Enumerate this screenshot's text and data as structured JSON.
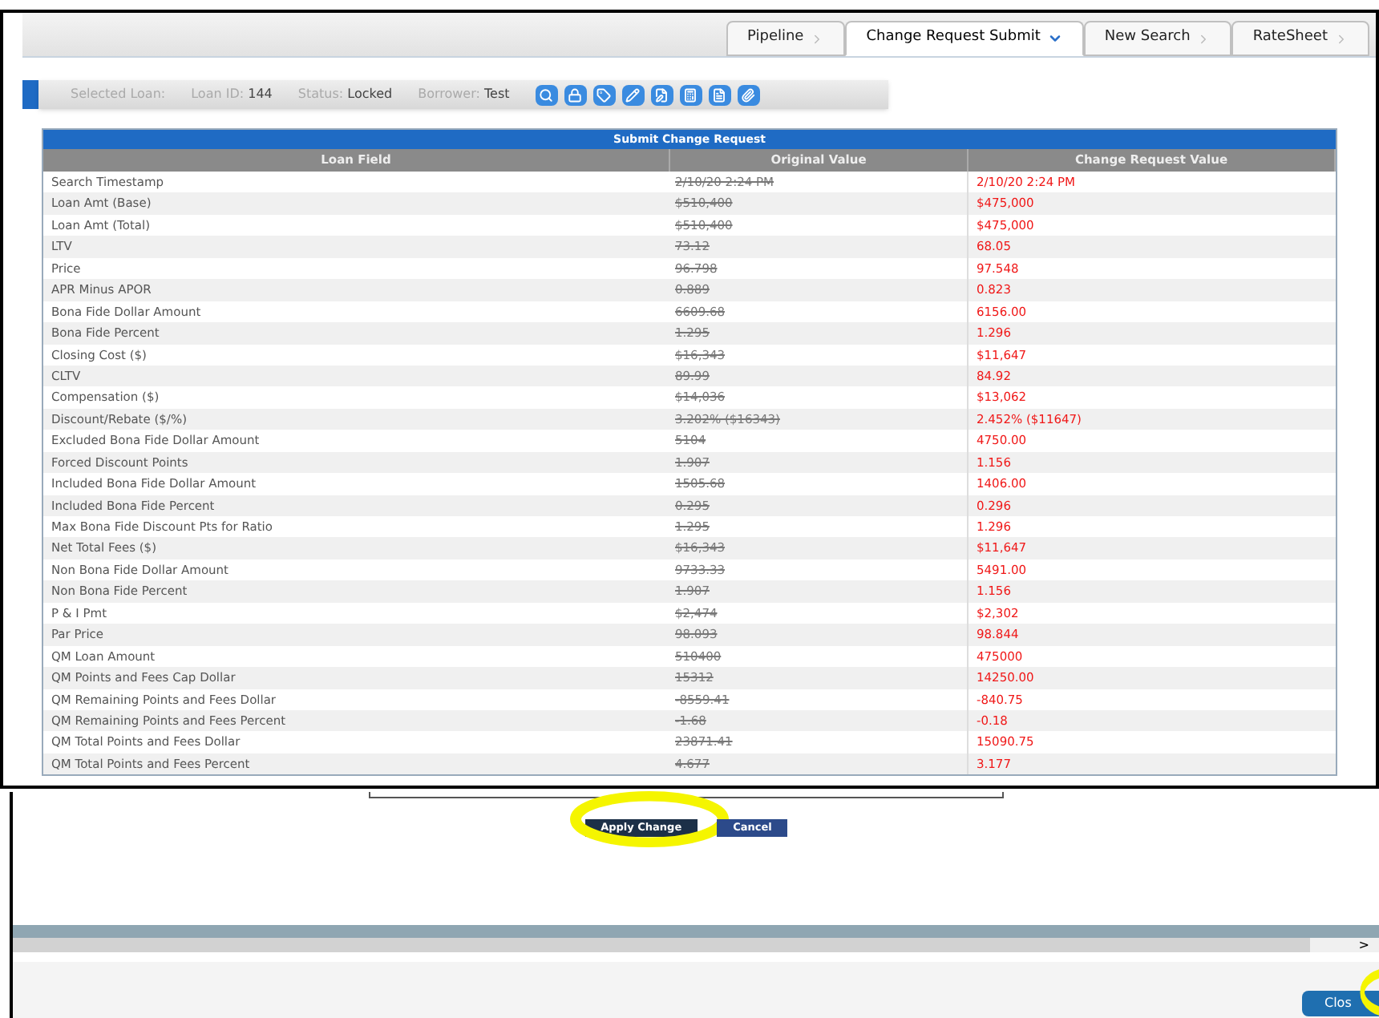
{
  "tabs": [
    {
      "label": "Pipeline",
      "selected": false
    },
    {
      "label": "Change Request Submit",
      "selected": true
    },
    {
      "label": "New Search",
      "selected": false
    },
    {
      "label": "RateSheet",
      "selected": false
    }
  ],
  "loan_bar": {
    "fields": [
      {
        "label": "Selected Loan:"
      },
      {
        "label": "Loan ID:",
        "value": "144"
      },
      {
        "label": "Status:",
        "value": "Locked"
      },
      {
        "label": "Borrower:",
        "value": "Test"
      }
    ]
  },
  "table": {
    "title": "Submit Change Request",
    "columns": [
      "Loan Field",
      "Original Value",
      "Change Request Value"
    ],
    "rows": [
      [
        "Search Timestamp",
        "2/10/20 2:24 PM",
        "2/10/20 2:24 PM"
      ],
      [
        "Loan Amt (Base)",
        "$510,400",
        "$475,000"
      ],
      [
        "Loan Amt (Total)",
        "$510,400",
        "$475,000"
      ],
      [
        "LTV",
        "73.12",
        "68.05"
      ],
      [
        "Price",
        "96.798",
        "97.548"
      ],
      [
        "APR Minus APOR",
        "0.889",
        "0.823"
      ],
      [
        "Bona Fide Dollar Amount",
        "6609.68",
        "6156.00"
      ],
      [
        "Bona Fide Percent",
        "1.295",
        "1.296"
      ],
      [
        "Closing Cost ($)",
        "$16,343",
        "$11,647"
      ],
      [
        "CLTV",
        "89.99",
        "84.92"
      ],
      [
        "Compensation ($)",
        "$14,036",
        "$13,062"
      ],
      [
        "Discount/Rebate ($/%)",
        "3.202% ($16343)",
        "2.452% ($11647)"
      ],
      [
        "Excluded Bona Fide Dollar Amount",
        "5104",
        "4750.00"
      ],
      [
        "Forced Discount Points",
        "1.907",
        "1.156"
      ],
      [
        "Included Bona Fide Dollar Amount",
        "1505.68",
        "1406.00"
      ],
      [
        "Included Bona Fide Percent",
        "0.295",
        "0.296"
      ],
      [
        "Max Bona Fide Discount Pts for Ratio",
        "1.295",
        "1.296"
      ],
      [
        "Net Total Fees ($)",
        "$16,343",
        "$11,647"
      ],
      [
        "Non Bona Fide Dollar Amount",
        "9733.33",
        "5491.00"
      ],
      [
        "Non Bona Fide Percent",
        "1.907",
        "1.156"
      ],
      [
        "P & I Pmt",
        "$2,474",
        "$2,302"
      ],
      [
        "Par Price",
        "98.093",
        "98.844"
      ],
      [
        "QM Loan Amount",
        "510400",
        "475000"
      ],
      [
        "QM Points and Fees Cap Dollar",
        "15312",
        "14250.00"
      ],
      [
        "QM Remaining Points and Fees Dollar",
        "-8559.41",
        "-840.75"
      ],
      [
        "QM Remaining Points and Fees Percent",
        "-1.68",
        "-0.18"
      ],
      [
        "QM Total Points and Fees Dollar",
        "23871.41",
        "15090.75"
      ],
      [
        "QM Total Points and Fees Percent",
        "4.677",
        "3.177"
      ]
    ]
  },
  "buttons": [
    {
      "label": "Apply Change",
      "highlighted": true
    },
    {
      "label": "Cancel",
      "highlighted": false
    }
  ],
  "scroll_arrow": ">",
  "close_button": {
    "label": "Clos",
    "highlighted": true
  }
}
